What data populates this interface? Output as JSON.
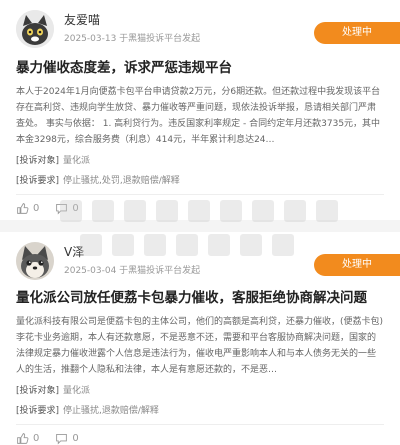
{
  "posts": [
    {
      "user": "友爱喵",
      "meta": "2025-03-13 于黑猫投诉平台发起",
      "status": "处理中",
      "title": "暴力催收态度差，诉求严惩违规平台",
      "body": "本人于2024年1月向便荔卡包平台申请贷款2万元，分6期还款。但还款过程中我发现该平台存在高利贷、违规向学生放贷、暴力催收等严重问题，现依法投诉举报，恳请相关部门严肃查处。 事实与依据： 1. 高利贷行为。违反国家利率规定 - 合同约定年月还款3735元，其中本金3298元，综合服务费（利息）414元，半年累计利息达24…",
      "demand_label": "[投诉对象]",
      "demand_value": "量化派",
      "request_label": "[投诉要求]",
      "request_value": "停止骚扰,处罚,退款赔偿/解释",
      "likes": "0",
      "comments": "0"
    },
    {
      "user": "V泽",
      "meta": "2025-03-04 于黑猫投诉平台发起",
      "status": "处理中",
      "title": "量化派公司放任便荔卡包暴力催收，客服拒绝协商解决问题",
      "body": "量化派科技有限公司是便荔卡包的主体公司，他们的高额是高利贷，还暴力催收，(便荔卡包)李花卡业务逾期，本人有还款意愿，不是恶意不还，需要和平台客服协商解决问题，国家的法律规定暴力催收泄露个人信息是违法行为，催收电严重影响本人和与本人债务无关的一些人的生活，推翻个人隐私和法律，本人是有意愿还款的，不是恶…",
      "demand_label": "[投诉对象]",
      "demand_value": "量化派",
      "request_label": "[投诉要求]",
      "request_value": "停止骚扰,退款赔偿/解释",
      "likes": "0",
      "comments": "0"
    }
  ],
  "colors": {
    "badge": "#f28b1e",
    "title": "#222222",
    "body": "#666666"
  },
  "icons": {
    "like": "thumbs-up-icon",
    "comment": "comment-icon"
  }
}
